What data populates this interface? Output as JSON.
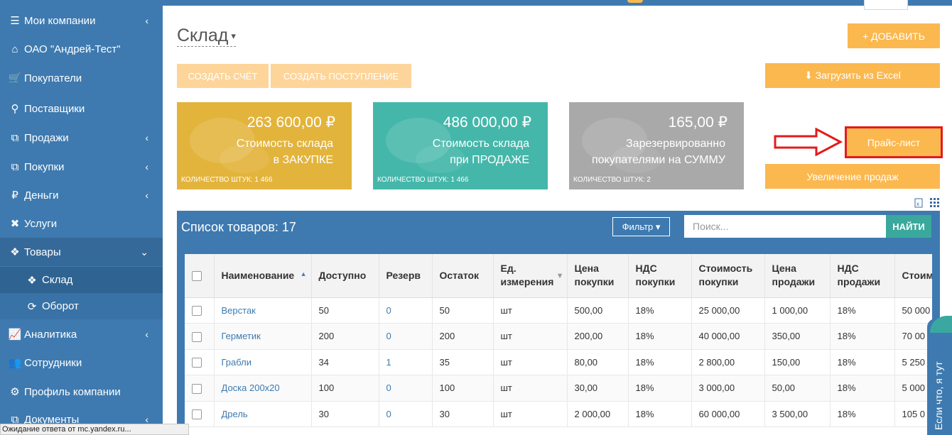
{
  "sidebar": {
    "items": [
      {
        "label": "Мои компании",
        "icon": "list-icon",
        "glyph": "☰",
        "chevron": "‹"
      },
      {
        "label": "ОАО \"Андрей-Тест\"",
        "icon": "home-icon",
        "glyph": "⌂",
        "chevron": ""
      },
      {
        "label": "Покупатели",
        "icon": "cart-icon",
        "glyph": "🛒",
        "chevron": ""
      },
      {
        "label": "Поставщики",
        "icon": "truck-icon",
        "glyph": "⚲",
        "chevron": ""
      },
      {
        "label": "Продажи",
        "icon": "sales-icon",
        "glyph": "⧉",
        "chevron": "‹"
      },
      {
        "label": "Покупки",
        "icon": "purchases-icon",
        "glyph": "⧉",
        "chevron": "‹"
      },
      {
        "label": "Деньги",
        "icon": "ruble-icon",
        "glyph": "₽",
        "chevron": "‹"
      },
      {
        "label": "Услуги",
        "icon": "tools-icon",
        "glyph": "✖",
        "chevron": ""
      },
      {
        "label": "Товары",
        "icon": "cubes-icon",
        "glyph": "❖",
        "chevron": "⌄"
      }
    ],
    "subitems": [
      {
        "label": "Склад",
        "icon": "cubes-icon",
        "glyph": "❖"
      },
      {
        "label": "Оборот",
        "icon": "refresh-icon",
        "glyph": "⟳"
      }
    ],
    "items_bottom": [
      {
        "label": "Аналитика",
        "icon": "chart-icon",
        "glyph": "📈",
        "chevron": "‹"
      },
      {
        "label": "Сотрудники",
        "icon": "users-icon",
        "glyph": "👥",
        "chevron": ""
      },
      {
        "label": "Профиль компании",
        "icon": "gear-icon",
        "glyph": "⚙",
        "chevron": ""
      },
      {
        "label": "Документы",
        "icon": "documents-icon",
        "glyph": "⧉",
        "chevron": "‹"
      }
    ]
  },
  "header": {
    "title": "Склад",
    "title_caret": "▾",
    "add_button": "+ ДОБАВИТЬ",
    "create_invoice": "СОЗДАТЬ СЧЁТ",
    "create_receipt": "СОЗДАТЬ ПОСТУПЛЕНИЕ",
    "upload_excel": "⬇ Загрузить из Excel",
    "price_list": "Прайс-лист",
    "increase_sales": "Увеличение продаж"
  },
  "cards": [
    {
      "amount": "263 600,00 ₽",
      "line1": "Стоимость склада",
      "line2": "в ЗАКУПКЕ",
      "qty": "КОЛИЧЕСТВО ШТУК: 1 466",
      "color": "#e3b43c"
    },
    {
      "amount": "486 000,00 ₽",
      "line1": "Стоимость склада",
      "line2": "при ПРОДАЖЕ",
      "qty": "КОЛИЧЕСТВО ШТУК: 1 466",
      "color": "#45b7aa"
    },
    {
      "amount": "165,00 ₽",
      "line1": "Зарезервированно",
      "line2": "покупателями на СУММУ",
      "qty": "КОЛИЧЕСТВО ШТУК: 2",
      "color": "#a9a9a9"
    }
  ],
  "products": {
    "title": "Список товаров: 17",
    "filter_label": "Фильтр ▾",
    "search_placeholder": "Поиск...",
    "search_button": "НАЙТИ",
    "columns": [
      "Наименование",
      "Доступно",
      "Резерв",
      "Остаток",
      "Ед. измерения",
      "Цена покупки",
      "НДС покупки",
      "Стоимость покупки",
      "Цена продажи",
      "НДС продажи",
      "Стоим прода"
    ],
    "rows": [
      [
        "Верстак",
        "50",
        "0",
        "50",
        "шт",
        "500,00",
        "18%",
        "25 000,00",
        "1 000,00",
        "18%",
        "50 000"
      ],
      [
        "Герметик",
        "200",
        "0",
        "200",
        "шт",
        "200,00",
        "18%",
        "40 000,00",
        "350,00",
        "18%",
        "70 00"
      ],
      [
        "Грабли",
        "34",
        "1",
        "35",
        "шт",
        "80,00",
        "18%",
        "2 800,00",
        "150,00",
        "18%",
        "5 250"
      ],
      [
        "Доска 200x20",
        "100",
        "0",
        "100",
        "шт",
        "30,00",
        "18%",
        "3 000,00",
        "50,00",
        "18%",
        "5 000"
      ],
      [
        "Дрель",
        "30",
        "0",
        "30",
        "шт",
        "2 000,00",
        "18%",
        "60 000,00",
        "3 500,00",
        "18%",
        "105 0"
      ]
    ]
  },
  "feedback_tab": "Если что, я тут",
  "status_bar": "Ожидание ответа от mc.yandex.ru..."
}
